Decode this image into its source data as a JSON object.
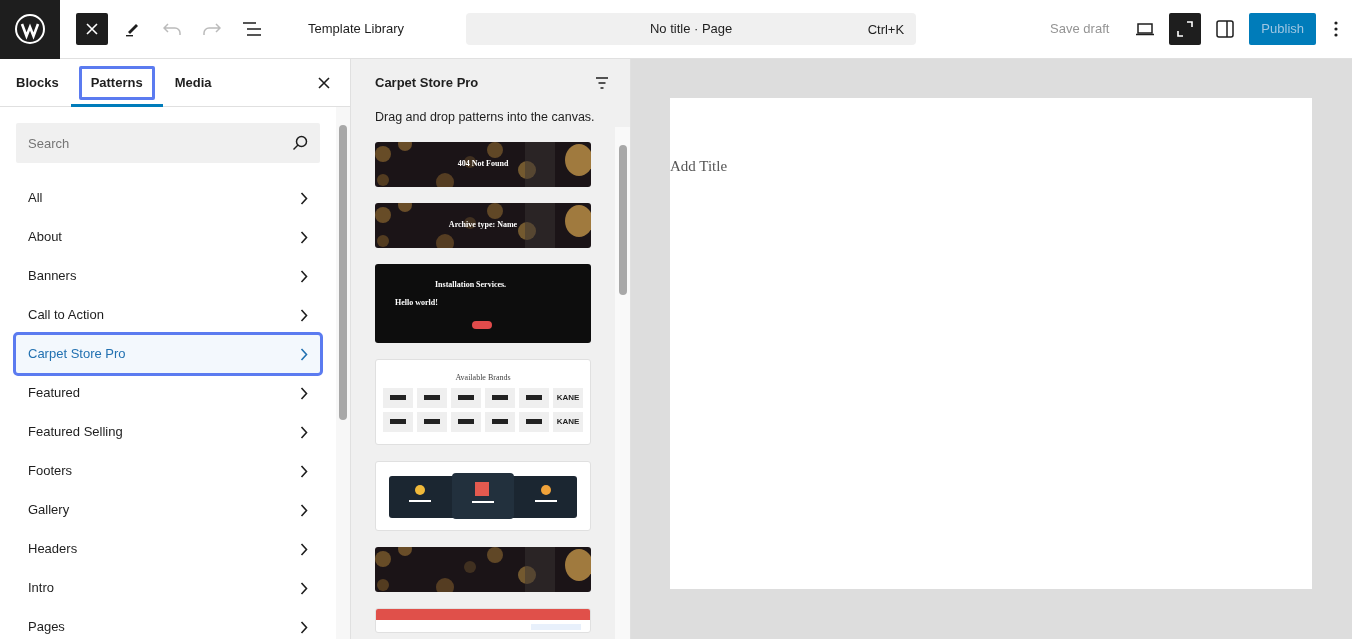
{
  "top_bar": {
    "title": "Template Library",
    "command": {
      "label": "No title · Page",
      "shortcut": "Ctrl+K"
    },
    "save_draft": "Save draft",
    "publish": "Publish",
    "fullscreen_on": true
  },
  "inserter": {
    "tabs": [
      {
        "label": "Blocks",
        "selected": false
      },
      {
        "label": "Patterns",
        "selected": true
      },
      {
        "label": "Media",
        "selected": false
      }
    ],
    "search": {
      "placeholder": "Search"
    },
    "categories": [
      {
        "label": "All",
        "selected": false
      },
      {
        "label": "About",
        "selected": false
      },
      {
        "label": "Banners",
        "selected": false
      },
      {
        "label": "Call to Action",
        "selected": false
      },
      {
        "label": "Carpet Store Pro",
        "selected": true
      },
      {
        "label": "Featured",
        "selected": false
      },
      {
        "label": "Featured Selling",
        "selected": false
      },
      {
        "label": "Footers",
        "selected": false
      },
      {
        "label": "Gallery",
        "selected": false
      },
      {
        "label": "Headers",
        "selected": false
      },
      {
        "label": "Intro",
        "selected": false
      },
      {
        "label": "Pages",
        "selected": false
      }
    ]
  },
  "patterns_panel": {
    "title": "Carpet Store Pro",
    "hint": "Drag and drop patterns into the canvas.",
    "patterns": [
      {
        "kind": "banner",
        "title": "404 Not Found"
      },
      {
        "kind": "banner",
        "title": "Archive type: Name"
      },
      {
        "kind": "post",
        "title": "Installation Services.",
        "post_title": "Hello world!"
      },
      {
        "kind": "brands",
        "title": "Available Brands",
        "brands": [
          "KANE",
          "KANE"
        ]
      },
      {
        "kind": "features"
      },
      {
        "kind": "banner"
      },
      {
        "kind": "header"
      }
    ]
  },
  "canvas": {
    "placeholder": "Add Title"
  }
}
